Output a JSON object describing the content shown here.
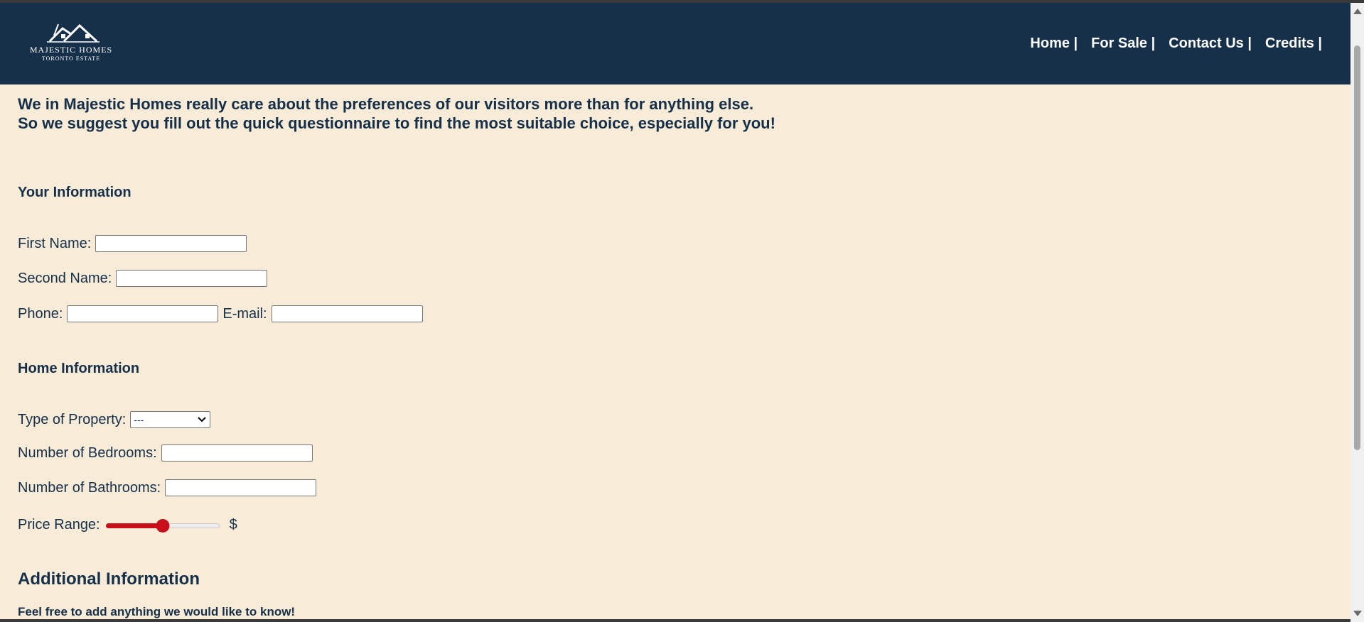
{
  "logo": {
    "title": "MAJESTIC HOMES",
    "subtitle": "TORONTO ESTATE"
  },
  "nav": [
    {
      "label": "Home |"
    },
    {
      "label": "For Sale |"
    },
    {
      "label": "Contact Us |"
    },
    {
      "label": "Credits |"
    }
  ],
  "intro": {
    "line1": "We in Majestic Homes really care about the preferences of our visitors more than for anything else.",
    "line2": "So we suggest you fill out the quick questionnaire to find the most suitable choice, especially for you!"
  },
  "your_info": {
    "title": "Your Information",
    "first_name_label": "First Name:",
    "first_name_value": "",
    "second_name_label": "Second Name:",
    "second_name_value": "",
    "phone_label": "Phone:",
    "phone_value": "",
    "email_label": "E-mail:",
    "email_value": ""
  },
  "home_info": {
    "title": "Home Information",
    "property_type_label": "Type of Property:",
    "property_type_selected": "---",
    "bedrooms_label": "Number of Bedrooms:",
    "bedrooms_value": "",
    "bathrooms_label": "Number of Bathrooms:",
    "bathrooms_value": "",
    "price_range_label": "Price Range:",
    "price_range_fraction": 0.5,
    "price_unit": "$"
  },
  "additional_info": {
    "title": "Additional Information",
    "subtitle": "Feel free to add anything we would like to know!"
  },
  "colors": {
    "header_bg": "#16304a",
    "page_bg": "#f8ebd8",
    "slider_accent": "#c8101c"
  }
}
